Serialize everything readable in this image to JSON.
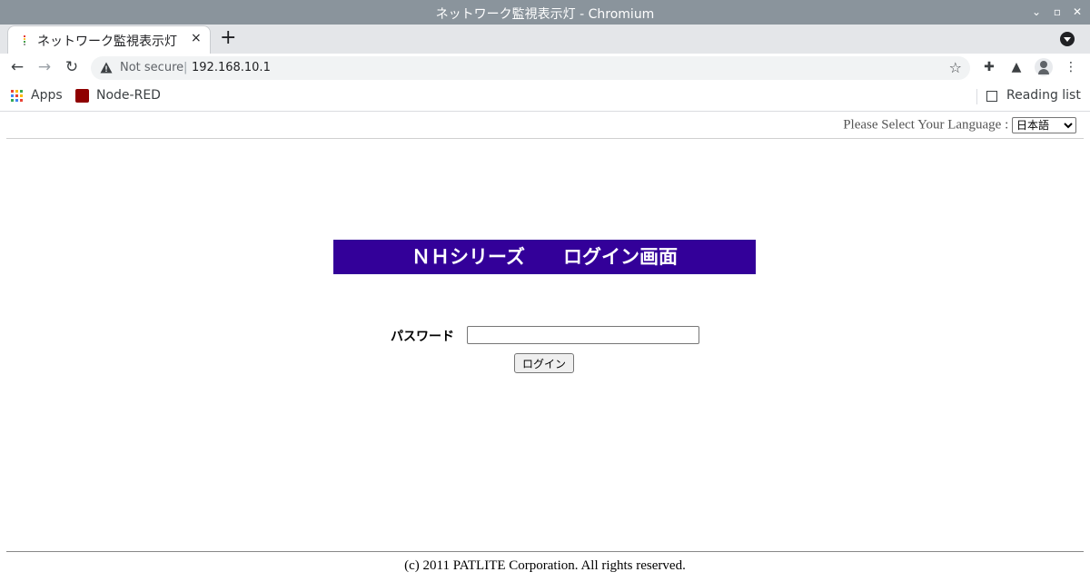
{
  "window": {
    "title": "ネットワーク監視表示灯 - Chromium"
  },
  "tab": {
    "title": "ネットワーク監視表示灯",
    "close": "×"
  },
  "toolbar": {
    "security_label": "Not secure",
    "separator": "|",
    "url": "192.168.10.1"
  },
  "bookmarks": {
    "apps_label": "Apps",
    "nodered_label": "Node-RED",
    "reading_list_label": "Reading list"
  },
  "page": {
    "language_prompt": "Please Select Your Language :",
    "language_selected": "日本語",
    "banner_title": "ＮＨシリーズ　　ログイン画面",
    "password_label": "パスワード",
    "password_value": "",
    "login_button": "ログイン",
    "copyright": "(c) 2011 PATLITE Corporation. All rights reserved."
  },
  "colors": {
    "titlebar": "#8a949c",
    "banner": "#330099"
  }
}
